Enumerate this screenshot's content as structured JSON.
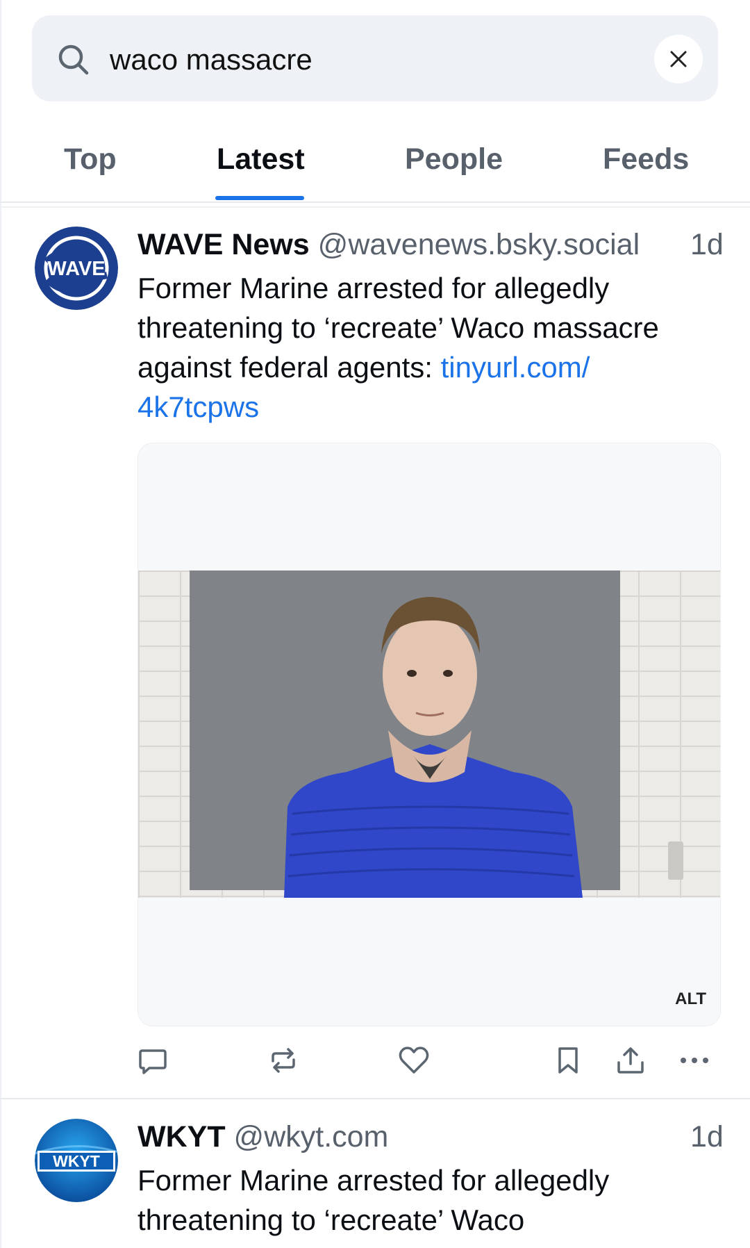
{
  "search": {
    "query": "waco massacre"
  },
  "tabs": [
    {
      "label": "Top"
    },
    {
      "label": "Latest"
    },
    {
      "label": "People"
    },
    {
      "label": "Feeds"
    }
  ],
  "posts": [
    {
      "avatar_text": "WAVE",
      "name": "WAVE News",
      "handle": "@wavenews.bsky.social",
      "time": "1d",
      "text_lines": [
        "Former Marine arrested for allegedly",
        "threatening to ‘recreate’ Waco massacre",
        "against federal agents: "
      ],
      "link_part1": "tinyurl.com/",
      "link_part2": "4k7tcpws",
      "image_alt_badge": "ALT"
    },
    {
      "avatar_text": "WKYT",
      "name": "WKYT",
      "handle": "@wkyt.com",
      "time": "1d",
      "text_lines": [
        "Former Marine arrested for allegedly",
        "threatening to ‘recreate’ Waco"
      ]
    }
  ],
  "actions": [
    {
      "icon": "reply-icon"
    },
    {
      "icon": "repost-icon"
    },
    {
      "icon": "like-icon"
    },
    {
      "icon": "bookmark-icon"
    },
    {
      "icon": "share-icon"
    },
    {
      "icon": "more-icon"
    }
  ],
  "colors": {
    "accent": "#1a73e8",
    "wave_blue": "#1c3f8f",
    "wkyt_blue": "#0d6fc4"
  }
}
